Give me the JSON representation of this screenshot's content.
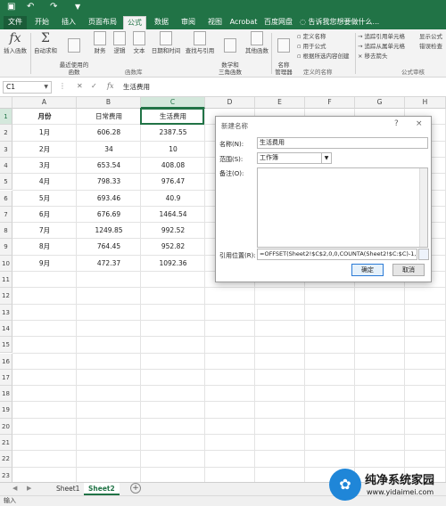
{
  "colors": {
    "brand": "#217346",
    "selection": "#217346",
    "dialog_accent": "#2a7ad6",
    "watermark": "#1f86d8"
  },
  "titlebar": {
    "icons": [
      "save-icon",
      "undo-icon",
      "redo-icon",
      "customize-icon"
    ]
  },
  "menu_tabs": {
    "file": "文件",
    "home": "开始",
    "insert": "插入",
    "page_layout": "页面布局",
    "formulas": "公式",
    "data": "数据",
    "review": "审阅",
    "view": "视图",
    "acrobat": "Acrobat",
    "baidu": "百度网盘",
    "tell_me": "告诉我您想要做什么..."
  },
  "ribbon": {
    "insert_function": "插入函数",
    "autosum": "自动求和",
    "recent": "最近使用的\n函数",
    "financial": "财务",
    "logical": "逻辑",
    "text": "文本",
    "datetime": "日期和时间",
    "lookup": "查找与引用",
    "math": "数学和\n三角函数",
    "more": "其他函数",
    "group_library": "函数库",
    "name_manager": "名称\n管理器",
    "define_name": "定义名称",
    "use_in_formula": "用于公式",
    "create_from_selection": "根据所选内容创建",
    "group_names": "定义的名称",
    "trace_precedents": "追踪引用单元格",
    "trace_dependents": "追踪从属单元格",
    "remove_arrows": "移去箭头",
    "show_formulas": "显示公式",
    "error_checking": "错误检查",
    "group_audit": "公式审核"
  },
  "formula_bar": {
    "name_box": "C1",
    "fx": "fx",
    "content": "生活费用"
  },
  "sheet": {
    "columns": [
      "A",
      "B",
      "C",
      "D",
      "E",
      "F",
      "G",
      "H"
    ],
    "rows": [
      "1",
      "2",
      "3",
      "4",
      "5",
      "6",
      "7",
      "8",
      "9",
      "10",
      "11",
      "12",
      "13",
      "14",
      "15",
      "16",
      "17",
      "18",
      "19",
      "20",
      "21",
      "22",
      "23"
    ],
    "headers": {
      "month": "月份",
      "daily": "日常费用",
      "living": "生活费用"
    },
    "data": [
      [
        "1月",
        "606.28",
        "2387.55"
      ],
      [
        "2月",
        "34",
        "10"
      ],
      [
        "3月",
        "653.54",
        "408.08"
      ],
      [
        "4月",
        "798.33",
        "976.47"
      ],
      [
        "5月",
        "693.46",
        "40.9"
      ],
      [
        "6月",
        "676.69",
        "1464.54"
      ],
      [
        "7月",
        "1249.85",
        "992.52"
      ],
      [
        "8月",
        "764.45",
        "952.82"
      ],
      [
        "9月",
        "472.37",
        "1092.36"
      ]
    ]
  },
  "dialog": {
    "title": "新建名称",
    "help": "?",
    "close": "×",
    "name_label": "名称(N):",
    "name_value": "生活费用",
    "scope_label": "范围(S):",
    "scope_value": "工作簿",
    "comment_label": "备注(O):",
    "refers_label": "引用位置(R):",
    "refers_value": "=OFFSET(Sheet2!$C$2,0,0,COUNTA(Sheet2!$C:$C)-1,1)",
    "ok": "确定",
    "cancel": "取消"
  },
  "sheet_tabs": [
    "Sheet1",
    "Sheet2"
  ],
  "add_sheet": "+",
  "status": "输入",
  "watermark": {
    "title": "纯净系统家园",
    "url": "www.yidaimei.com"
  }
}
